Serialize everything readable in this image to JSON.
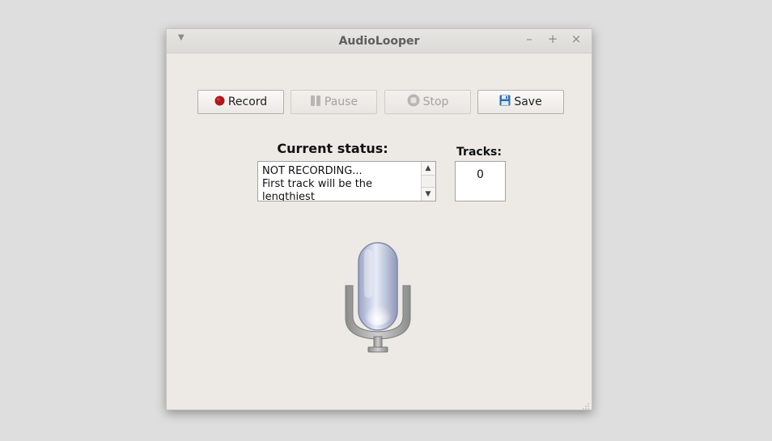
{
  "window": {
    "title": "AudioLooper",
    "menu_icon": "chevron-down-icon",
    "minimize_glyph": "–",
    "maximize_glyph": "+",
    "close_glyph": "×"
  },
  "toolbar": {
    "record_label": "Record",
    "pause_label": "Pause",
    "stop_label": "Stop",
    "save_label": "Save",
    "record_enabled": true,
    "pause_enabled": false,
    "stop_enabled": false,
    "save_enabled": true
  },
  "status": {
    "label": "Current status:",
    "lines": [
      "NOT RECORDING...",
      "First track will be the",
      "lengthiest"
    ]
  },
  "tracks": {
    "label": "Tracks:",
    "count": "0"
  },
  "colors": {
    "record_dot": "#b3141b",
    "save_icon": "#2f6fb0",
    "window_bg": "#edeae6",
    "desktop_bg": "#dedede"
  },
  "icons": {
    "record": "record-dot-icon",
    "pause": "pause-icon",
    "stop": "stop-icon",
    "save": "floppy-disk-icon",
    "illustration": "microphone-icon"
  }
}
